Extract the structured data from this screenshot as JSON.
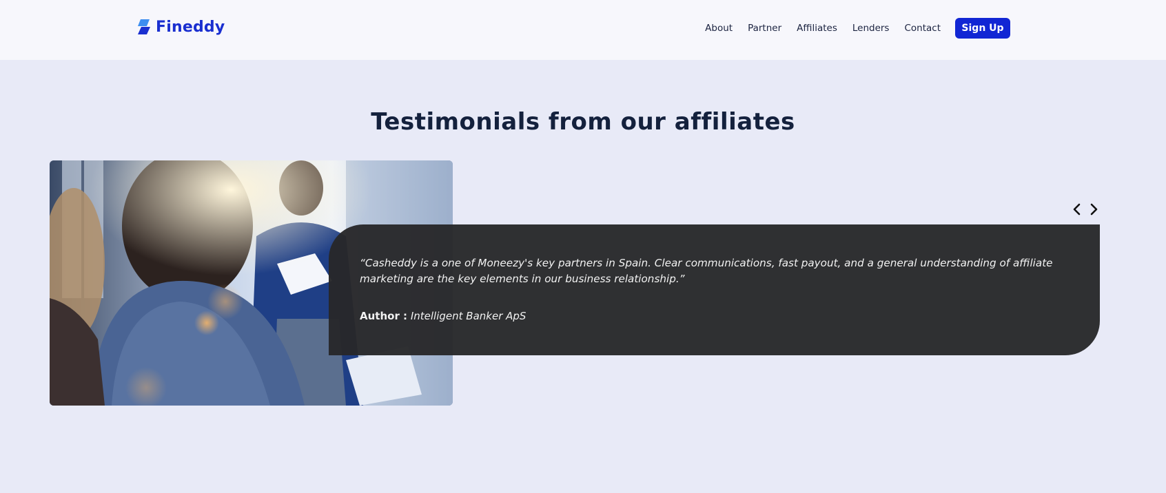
{
  "brand": {
    "name": "Fineddy",
    "color": "#1a2fd0",
    "logo_icon": "fineddy-logo-mark"
  },
  "nav": {
    "items": [
      {
        "label": "About"
      },
      {
        "label": "Partner"
      },
      {
        "label": "Affiliates"
      },
      {
        "label": "Lenders"
      },
      {
        "label": "Contact"
      }
    ],
    "signup_label": "Sign Up",
    "signup_color": "#1126d4"
  },
  "testimonials": {
    "title": "Testimonials from our affiliates",
    "prev_icon": "chevron-left-icon",
    "next_icon": "chevron-right-icon",
    "image": "affiliates-meeting-photo",
    "current": {
      "quote": "“Casheddy is a one of Moneezy's key partners in Spain. Clear communications, fast payout, and a general understanding of affiliate marketing are the key elements in our business relationship.”",
      "author_label": "Author :",
      "author_name": "Intelligent Banker ApS"
    }
  },
  "colors": {
    "page_background": "#e8eaf7",
    "header_background": "#f7f7fc",
    "title_color": "#14213d",
    "card_background": "#28282a"
  }
}
